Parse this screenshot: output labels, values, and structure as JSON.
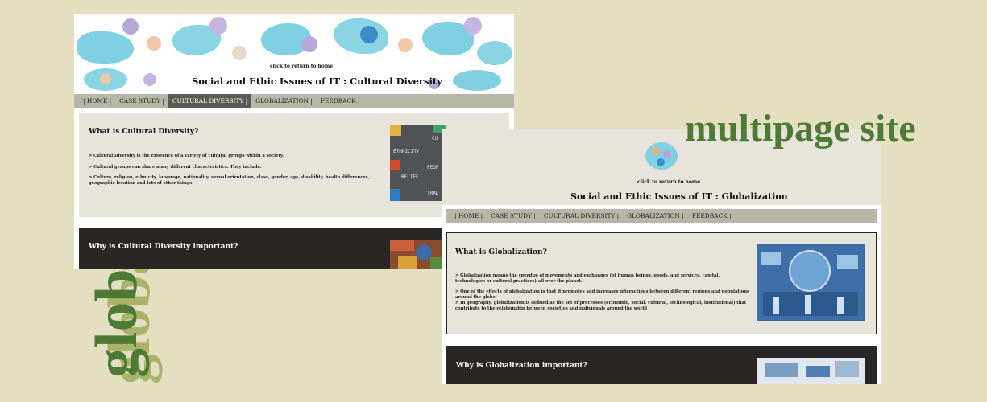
{
  "side_word": "globalization",
  "headline": "multipage site",
  "site_nav": [
    "| HOME |",
    "CASE STUDY |",
    "CULTURAL DIVERSITY |",
    "GLOBALIZATION |",
    "FEEDBACK |"
  ],
  "page1": {
    "click_home": "click to return to home",
    "title": "Social and Ethic Issues of IT : Cultural Diversity",
    "active_nav_index": 2,
    "section1_title": "What is Cultural Diversity?",
    "bullets": [
      "> Cultural Diversity is the existence of a variety of cultural groups within a society.",
      "> Cultural groups can share many different characteristics. They include:",
      "> Culture, religion, ethnicity, language, nationality, sexual orientation, class, gender, age, disability, health differences, geographic location and lots of other things."
    ],
    "image_words": [
      "ETHNICITY",
      "BELIEF",
      "CU",
      "PEOP",
      "TRAD"
    ],
    "section2_title": "Why is Cultural Diversity important?"
  },
  "page2": {
    "click_home": "click to return to home",
    "title": "Social and Ethic Issues of IT : Globalization",
    "section1_title": "What is Globalization?",
    "bullets": [
      "> Globalization means the speedup of movements and exchanges (of human beings, goods, and services, capital, technologies or cultural practices) all over the planet.",
      "> One of the effects of globalization is that it promotes and increases interactions between different regions and populations around the globe.",
      "> In geography, globalization is defined as the set of processes (economic, social, cultural, technological, institutional) that contribute to the relationship between societies and individuals around the world"
    ],
    "section2_title": "Why is Globalization important?"
  },
  "colors": {
    "background": "#e4dfc0",
    "green": "#4f7a35",
    "light_green": "#a9b46a",
    "nav": "#b8b6a6",
    "nav_active": "#5b5a52",
    "section_light": "#e7e4dc",
    "section_dark": "#2a2626"
  }
}
